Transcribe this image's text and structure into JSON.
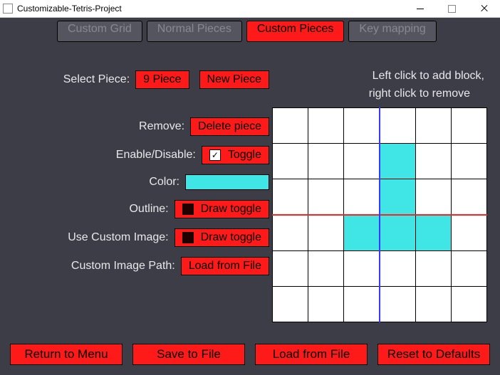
{
  "window": {
    "title": "Customizable-Tetris-Project"
  },
  "tabs": {
    "custom_grid": "Custom Grid",
    "normal_pieces": "Normal Pieces",
    "custom_pieces": "Custom Pieces",
    "key_mapping": "Key mapping",
    "active": "custom_pieces"
  },
  "hint": {
    "line1": "Left click to add block,",
    "line2": "right click to remove"
  },
  "labels": {
    "select_piece": "Select Piece:",
    "remove": "Remove:",
    "enable_disable": "Enable/Disable:",
    "color": "Color:",
    "outline": "Outline:",
    "use_custom_image": "Use Custom Image:",
    "custom_image_path": "Custom Image Path:"
  },
  "buttons": {
    "piece_selector": "9 Piece",
    "new_piece": "New Piece",
    "delete_piece": "Delete piece",
    "toggle": "Toggle",
    "draw_toggle_outline": "Draw toggle",
    "draw_toggle_image": "Draw toggle",
    "load_image": "Load from File",
    "return_menu": "Return to Menu",
    "save_file": "Save to File",
    "load_file": "Load from File",
    "reset_defaults": "Reset to Defaults"
  },
  "state": {
    "enable_checked": true,
    "outline_checked": false,
    "custom_image_checked": false,
    "color_hex": "#40e6e6"
  },
  "piece_grid": {
    "rows": 6,
    "cols": 6,
    "on_cells": [
      [
        1,
        3
      ],
      [
        2,
        3
      ],
      [
        3,
        2
      ],
      [
        3,
        3
      ],
      [
        3,
        4
      ]
    ]
  }
}
